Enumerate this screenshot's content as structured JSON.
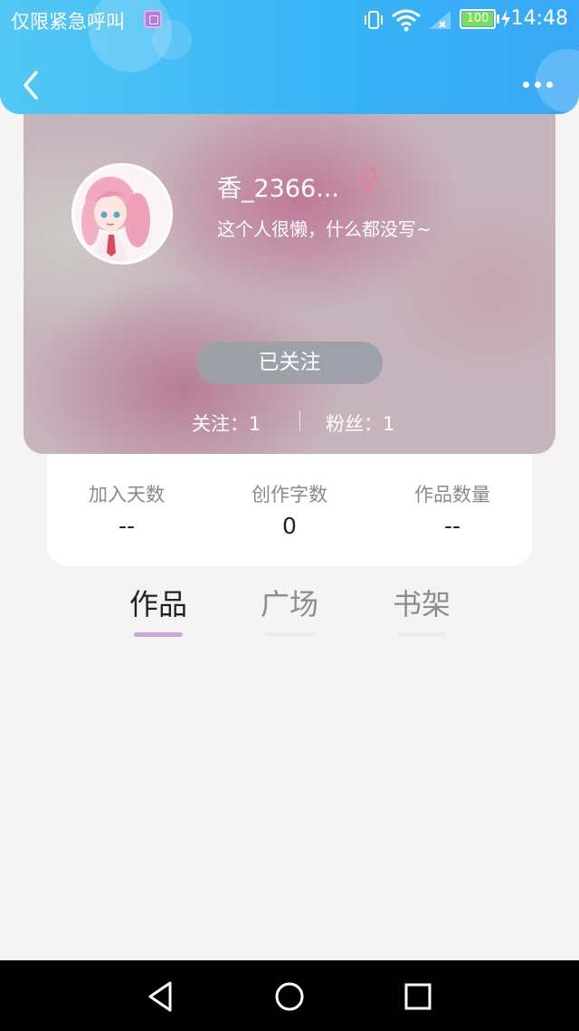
{
  "status_bar": {
    "carrier": "仅限紧急呼叫",
    "battery": "100",
    "time": "14:48"
  },
  "profile": {
    "username": "香_2366...",
    "bio": "这个人很懒，什么都没写~",
    "follow_button": "已关注",
    "following": "关注：1",
    "fans": "粉丝：1",
    "gender_color": "#e2809a"
  },
  "stats": [
    {
      "label": "加入天数",
      "value": "--"
    },
    {
      "label": "创作字数",
      "value": "0"
    },
    {
      "label": "作品数量",
      "value": "--"
    }
  ],
  "tabs": [
    {
      "label": "作品",
      "active": true
    },
    {
      "label": "广场",
      "active": false
    },
    {
      "label": "书架",
      "active": false
    }
  ],
  "colors": {
    "header_blue": "#37b3f6",
    "tab_underline": "#c6aadd",
    "follow_button_bg": "#9ca0a8"
  },
  "icons": {
    "back": "back-arrow-icon",
    "more": "more-dots-icon",
    "gender": "female-icon",
    "nav_back": "triangle-back-icon",
    "nav_home": "circle-home-icon",
    "nav_recent": "square-recent-icon"
  }
}
